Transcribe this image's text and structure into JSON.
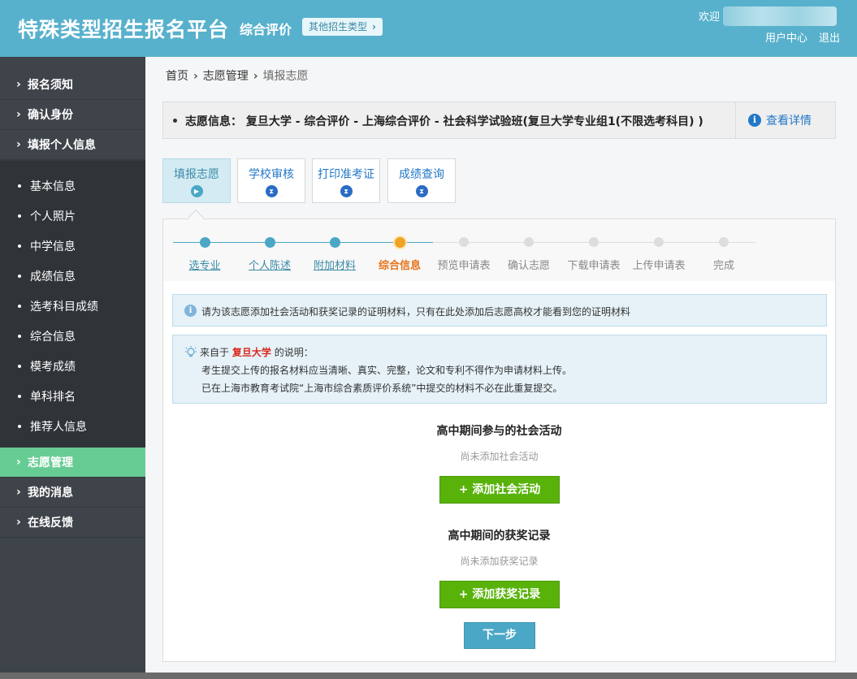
{
  "header": {
    "brand": "特殊类型招生报名平台",
    "mode": "综合评价",
    "other_type_label": "其他招生类型",
    "welcome": "欢迎",
    "user_center": "用户中心",
    "logout": "退出"
  },
  "sidebar": {
    "top_items": [
      {
        "label": "报名须知"
      },
      {
        "label": "确认身份"
      },
      {
        "label": "填报个人信息"
      }
    ],
    "sub_items": [
      {
        "label": "基本信息"
      },
      {
        "label": "个人照片"
      },
      {
        "label": "中学信息"
      },
      {
        "label": "成绩信息"
      },
      {
        "label": "选考科目成绩"
      },
      {
        "label": "综合信息"
      },
      {
        "label": "模考成绩"
      },
      {
        "label": "单科排名"
      },
      {
        "label": "推荐人信息"
      }
    ],
    "bottom_items": [
      {
        "label": "志愿管理",
        "active": true
      },
      {
        "label": "我的消息"
      },
      {
        "label": "在线反馈"
      }
    ]
  },
  "breadcrumb": {
    "home": "首页",
    "level2": "志愿管理",
    "current": "填报志愿"
  },
  "info_bar": {
    "text": "志愿信息： 复旦大学 - 综合评价 - 上海综合评价 - 社会科学试验班(复旦大学专业组1(不限选考科目) )",
    "detail_link": "查看详情"
  },
  "tabs": [
    {
      "label": "填报志愿",
      "active": true
    },
    {
      "label": "学校审核"
    },
    {
      "label": "打印准考证"
    },
    {
      "label": "成绩查询"
    }
  ],
  "steps": [
    {
      "label": "选专业",
      "state": "done"
    },
    {
      "label": "个人陈述",
      "state": "done"
    },
    {
      "label": "附加材料",
      "state": "done"
    },
    {
      "label": "综合信息",
      "state": "current"
    },
    {
      "label": "预览申请表",
      "state": "todo"
    },
    {
      "label": "确认志愿",
      "state": "todo"
    },
    {
      "label": "下载申请表",
      "state": "todo"
    },
    {
      "label": "上传申请表",
      "state": "todo"
    },
    {
      "label": "完成",
      "state": "todo"
    }
  ],
  "notice": "请为该志愿添加社会活动和获奖记录的证明材料，只有在此处添加后志愿高校才能看到您的证明材料",
  "explain": {
    "prefix": "来自于",
    "school": "复旦大学",
    "suffix": "的说明：",
    "line2": "考生提交上传的报名材料应当清晰、真实、完整，论文和专利不得作为申请材料上传。",
    "line3": "已在上海市教育考试院“上海市综合素质评价系统”中提交的材料不必在此重复提交。"
  },
  "activities": {
    "title": "高中期间参与的社会活动",
    "empty": "尚未添加社会活动",
    "button": "+ 添加社会活动"
  },
  "awards": {
    "title": "高中期间的获奖记录",
    "empty": "尚未添加获奖记录",
    "button": "+ 添加获奖记录"
  },
  "next_button": "下一步",
  "colors": {
    "header": "#58b1cc",
    "sidebar": "#3e4449",
    "sidebar_active": "#67cc94",
    "accent_blue": "#4aa7c6",
    "current_step": "#f0a323",
    "green_button": "#58b20a",
    "school_red": "#d9261c"
  }
}
